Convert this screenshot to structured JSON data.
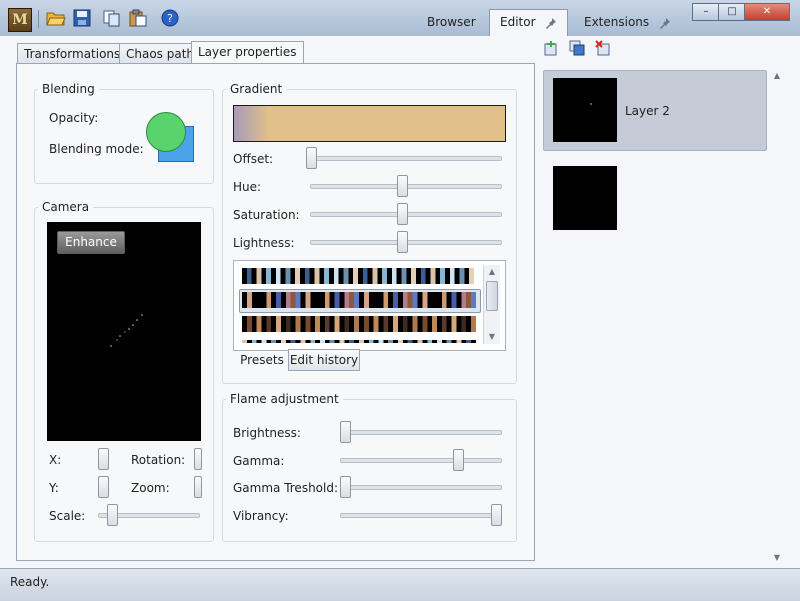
{
  "app": {
    "logo_letter": "M",
    "status": "Ready."
  },
  "toolbar": {
    "icons": [
      "open-folder-icon",
      "save-icon",
      "copy-icon",
      "paste-icon",
      "help-icon"
    ]
  },
  "main_tabs": [
    {
      "label": "Browser",
      "active": false,
      "pinned": false
    },
    {
      "label": "Editor",
      "active": true,
      "pinned": true
    },
    {
      "label": "Extensions",
      "active": false,
      "pinned": true
    }
  ],
  "window_controls": {
    "minimize": "–",
    "maximize": "□",
    "close": "✕"
  },
  "editor_tabs": [
    {
      "label": "Transformations",
      "active": false
    },
    {
      "label": "Chaos path",
      "active": false
    },
    {
      "label": "Layer properties",
      "active": true
    }
  ],
  "blending": {
    "title": "Blending",
    "opacity_label": "Opacity:",
    "mode_label": "Blending mode:",
    "colors": {
      "front": "#5ad36c",
      "back": "#4da3e8"
    }
  },
  "camera": {
    "title": "Camera",
    "enhance_label": "Enhance",
    "x_label": "X:",
    "y_label": "Y:",
    "rotation_label": "Rotation:",
    "zoom_label": "Zoom:",
    "scale_label": "Scale:",
    "scale_value": 0.1
  },
  "gradient": {
    "title": "Gradient",
    "offset_label": "Offset:",
    "hue_label": "Hue:",
    "saturation_label": "Saturation:",
    "lightness_label": "Lightness:",
    "offset_value": 0.0,
    "hue_value": 0.5,
    "saturation_value": 0.5,
    "lightness_value": 0.5,
    "preview_colors": {
      "start": "#a79bb8",
      "main": "#e2c08a"
    },
    "presets_tab": "Presets",
    "history_tab": "Edit history"
  },
  "flame_adjustment": {
    "title": "Flame adjustment",
    "brightness_label": "Brightness:",
    "gamma_label": "Gamma:",
    "gamma_threshold_label": "Gamma Treshold:",
    "vibrancy_label": "Vibrancy:",
    "brightness_value": 0.0,
    "gamma_value": 0.75,
    "gamma_threshold_value": 0.0,
    "vibrancy_value": 1.0
  },
  "layers": {
    "toolbar_icons": [
      "add-layer-icon",
      "duplicate-layer-icon",
      "delete-layer-icon"
    ],
    "items": [
      {
        "label": "Layer 2",
        "selected": true
      },
      {
        "label": "",
        "selected": false
      }
    ]
  }
}
